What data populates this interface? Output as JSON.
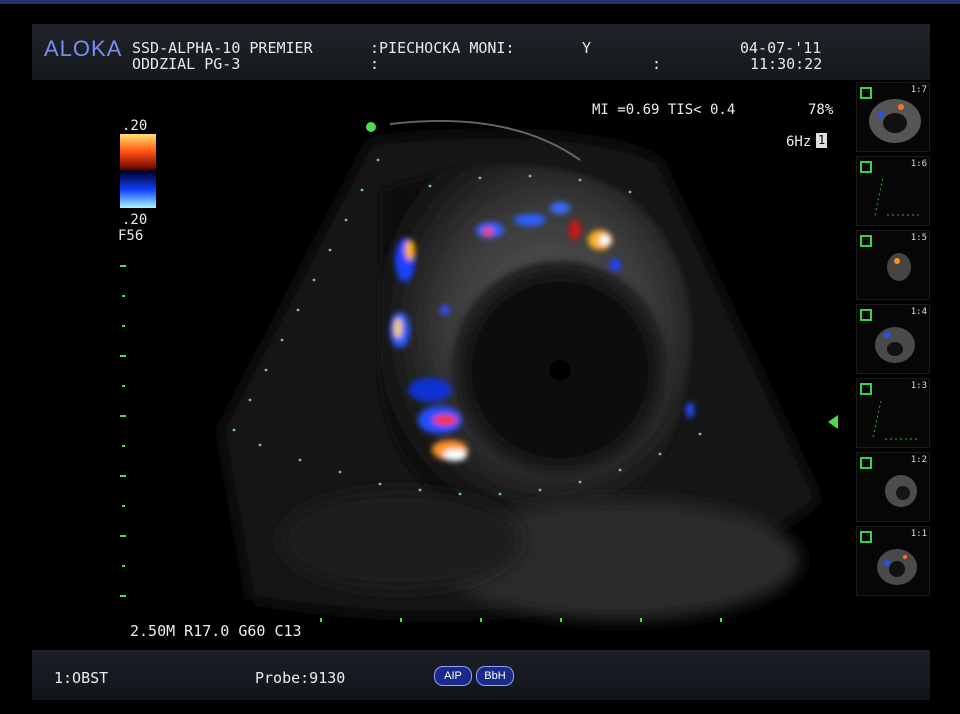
{
  "header": {
    "brand": "ALOKA",
    "model": "SSD-ALPHA-10 PREMIER",
    "patient": ":PIECHOCKA MONI:",
    "patient_flag": "Y",
    "department": "ODDZIAL PG-3",
    "dept_sep": ":",
    "sep2": ":",
    "date": "04-07-'11",
    "time": "11:30:22"
  },
  "overlay": {
    "mi_tis": "MI =0.69 TIS< 0.4",
    "power": "78%",
    "frame_rate": "6Hz",
    "frame_rate_badge": "1",
    "scale_top": ".20",
    "scale_bottom": ".20",
    "scale_mode": "F56",
    "params": "2.50M R17.0 G60 C13"
  },
  "thumbnails": [
    {
      "label": "1:7"
    },
    {
      "label": "1:6"
    },
    {
      "label": "1:5"
    },
    {
      "label": "1:4"
    },
    {
      "label": "1:3"
    },
    {
      "label": "1:2"
    },
    {
      "label": "1:1"
    }
  ],
  "footer": {
    "exam": "1:OBST",
    "probe": "Probe:9130",
    "aip_button": "AIP",
    "bbh_button": "BbH"
  },
  "colors": {
    "brand": "#7b8df0",
    "marker": "#4ddc4d",
    "pill_bg": "#1a2a8a"
  }
}
